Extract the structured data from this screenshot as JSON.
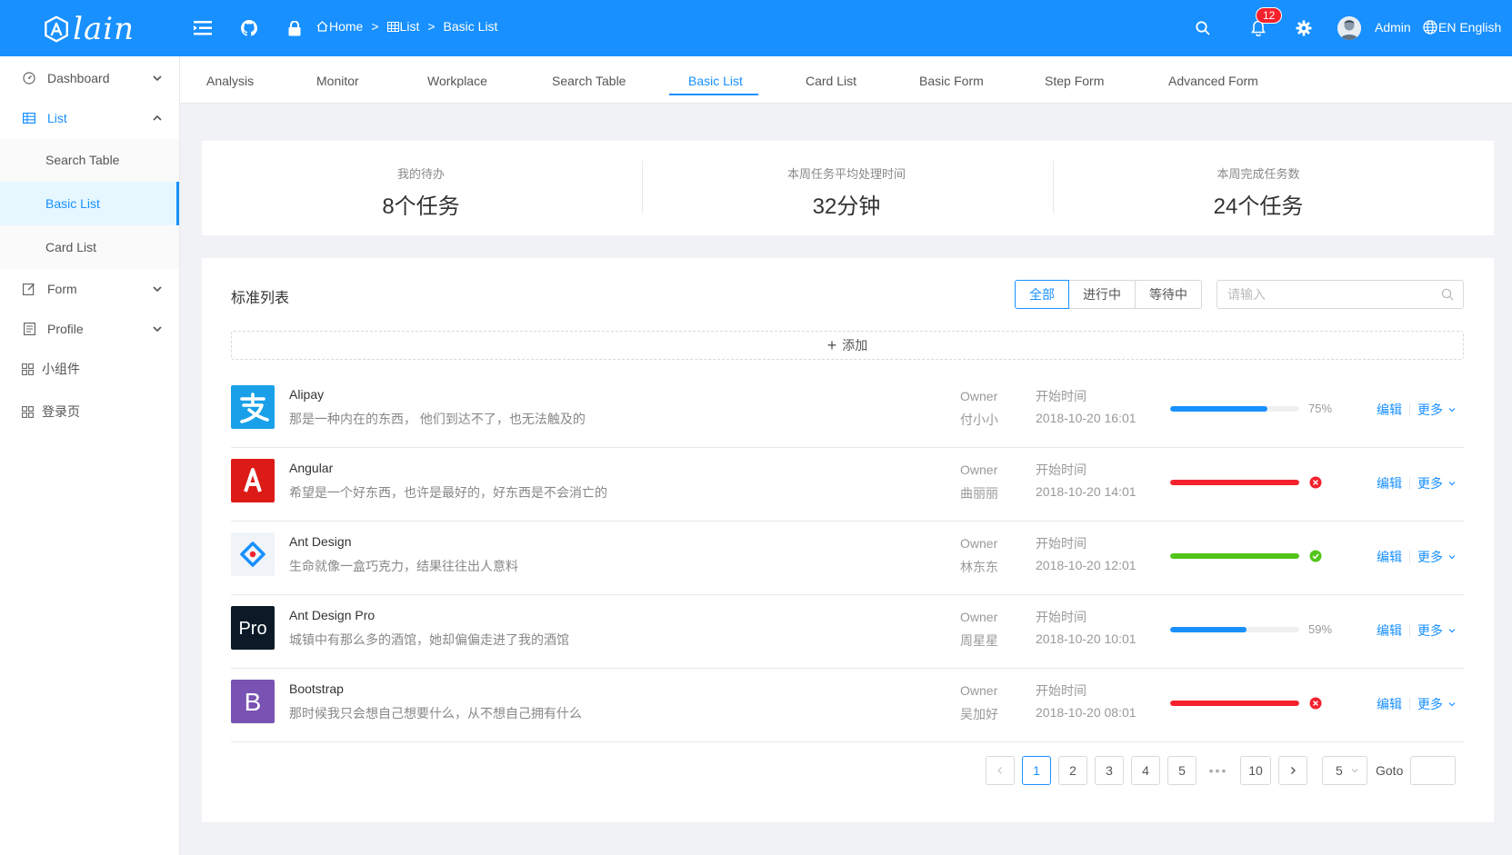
{
  "header": {
    "logo_text": "lain",
    "breadcrumb": [
      {
        "label": "Home"
      },
      {
        "label": "List"
      },
      {
        "label": "Basic List"
      }
    ],
    "breadcrumb_separator": ">",
    "notification_count": "12",
    "username": "Admin",
    "language": "EN English",
    "brand_color": "#1890ff"
  },
  "sidebar": {
    "items": [
      {
        "label": "Dashboard",
        "icon": "dashboard-icon"
      },
      {
        "label": "List",
        "icon": "table-icon"
      },
      {
        "label": "Form",
        "icon": "edit-icon"
      },
      {
        "label": "Profile",
        "icon": "profile-icon"
      },
      {
        "label": "小组件",
        "icon": "appstore-icon"
      },
      {
        "label": "登录页",
        "icon": "appstore-icon"
      }
    ],
    "list_children": [
      {
        "label": "Search Table"
      },
      {
        "label": "Basic List"
      },
      {
        "label": "Card List"
      }
    ]
  },
  "tabs": [
    {
      "label": "Analysis"
    },
    {
      "label": "Monitor"
    },
    {
      "label": "Workplace"
    },
    {
      "label": "Search Table"
    },
    {
      "label": "Basic List"
    },
    {
      "label": "Card List"
    },
    {
      "label": "Basic Form"
    },
    {
      "label": "Step Form"
    },
    {
      "label": "Advanced Form"
    }
  ],
  "stats": [
    {
      "label": "我的待办",
      "value": "8个任务"
    },
    {
      "label": "本周任务平均处理时间",
      "value": "32分钟"
    },
    {
      "label": "本周完成任务数",
      "value": "24个任务"
    }
  ],
  "list_card": {
    "title": "标准列表",
    "filters": [
      {
        "label": "全部"
      },
      {
        "label": "进行中"
      },
      {
        "label": "等待中"
      }
    ],
    "search_placeholder": "请输入",
    "add_label": "添加",
    "owner_label": "Owner",
    "time_label": "开始时间",
    "edit_label": "编辑",
    "more_label": "更多",
    "items": [
      {
        "title": "Alipay",
        "desc": "那是一种内在的东西， 他们到达不了，也无法触及的",
        "owner": "付小小",
        "time": "2018-10-20 16:01",
        "progress": 75,
        "percent_text": "75%",
        "status": "active",
        "logo_color": "#1aa0e8",
        "logo_icon": "alipay-logo"
      },
      {
        "title": "Angular",
        "desc": "希望是一个好东西，也许是最好的，好东西是不会消亡的",
        "owner": "曲丽丽",
        "time": "2018-10-20 14:01",
        "progress": 100,
        "status": "exception",
        "logo_color": "#dd1b16",
        "logo_icon": "angular-logo"
      },
      {
        "title": "Ant Design",
        "desc": "生命就像一盒巧克力，结果往往出人意料",
        "owner": "林东东",
        "time": "2018-10-20 12:01",
        "progress": 100,
        "status": "success",
        "logo_color": "#f0f4f8",
        "logo_icon": "ant-design-logo"
      },
      {
        "title": "Ant Design Pro",
        "desc": "城镇中有那么多的酒馆，她却偏偏走进了我的酒馆",
        "owner": "周星星",
        "time": "2018-10-20 10:01",
        "progress": 59,
        "percent_text": "59%",
        "status": "active",
        "logo_color": "#0b1a26",
        "logo_icon": "ant-design-pro-logo"
      },
      {
        "title": "Bootstrap",
        "desc": "那时候我只会想自己想要什么，从不想自己拥有什么",
        "owner": "吴加好",
        "time": "2018-10-20 08:01",
        "progress": 100,
        "status": "exception",
        "logo_color": "#7952b3",
        "logo_icon": "bootstrap-logo"
      }
    ],
    "status_colors": {
      "active": "#1890ff",
      "exception": "#f5222d",
      "success": "#52c41a"
    }
  },
  "pagination": {
    "pages": [
      "1",
      "2",
      "3",
      "4",
      "5",
      "10"
    ],
    "current": "1",
    "ellipsis": "•••",
    "page_size": "5",
    "goto_label": "Goto"
  }
}
